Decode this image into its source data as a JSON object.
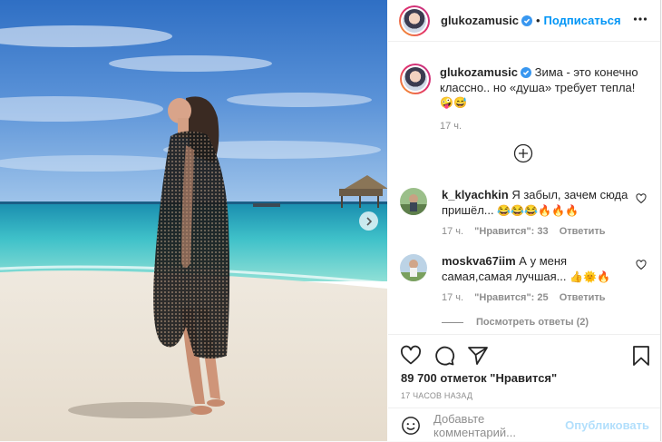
{
  "post": {
    "username": "glukozamusic",
    "follow_label": "Подписаться",
    "dot": "•",
    "caption_text": "Зима - это конечно классно.. но «душа» требует тепла!",
    "caption_emojis": "🤪😅",
    "caption_time": "17 ч."
  },
  "comments": [
    {
      "username": "k_klyachkin",
      "text": "Я забыл, зачем сюда пришёл...",
      "emojis": "😂😂😂🔥🔥🔥",
      "time": "17 ч.",
      "likes": "\"Нравится\": 33",
      "reply": "Ответить"
    },
    {
      "username": "moskva67iim",
      "text": "А у меня самая,самая лучшая...",
      "emojis": "👍🌞🔥",
      "time": "17 ч.",
      "likes": "\"Нравится\": 25",
      "reply": "Ответить"
    }
  ],
  "view_replies": "Посмотреть ответы (2)",
  "likes_count": "89 700 отметок \"Нравится\"",
  "posted_ago": "17 ЧАСОВ НАЗАД",
  "comment_box": {
    "placeholder": "Добавьте комментарий...",
    "publish": "Опубликовать"
  },
  "colors": {
    "accent": "#0095f6",
    "publish_disabled": "#b2dffc",
    "muted": "#8e8e8e",
    "verified": "#3897f0"
  },
  "icons": {
    "verified": "verified-badge-icon",
    "more": "more-options-icon",
    "load_more": "plus-circle-icon",
    "like": "heart-icon",
    "comment": "comment-bubble-icon",
    "share": "paper-plane-icon",
    "save": "bookmark-icon",
    "emoji": "emoji-smiley-icon",
    "next": "chevron-right-icon"
  }
}
